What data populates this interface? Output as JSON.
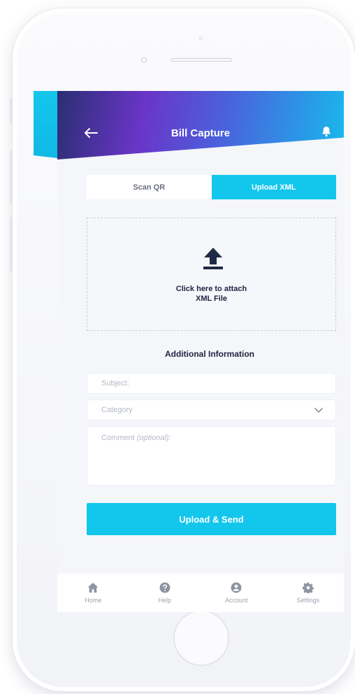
{
  "header": {
    "title": "Bill Capture"
  },
  "tabs": [
    {
      "label": "Scan QR",
      "active": false
    },
    {
      "label": "Upload XML",
      "active": true
    }
  ],
  "dropzone": {
    "line1": "Click here to attach",
    "line2": "XML File",
    "icon": "upload-icon"
  },
  "form": {
    "section_title": "Additional Information",
    "subject_placeholder": "Subject:",
    "category_placeholder": "Category",
    "comment_placeholder": "Comment",
    "comment_optional": "(optional):"
  },
  "primary_button": {
    "label": "Upload & Send"
  },
  "bottom_nav": [
    {
      "label": "Home",
      "icon": "home-icon"
    },
    {
      "label": "Help",
      "icon": "help-icon"
    },
    {
      "label": "Account",
      "icon": "account-icon"
    },
    {
      "label": "Settings",
      "icon": "settings-icon"
    }
  ],
  "colors": {
    "accent": "#13c6ec",
    "gradient_start": "#2a2f72",
    "gradient_mid": "#6a35c8",
    "text_dark": "#1f2340"
  }
}
